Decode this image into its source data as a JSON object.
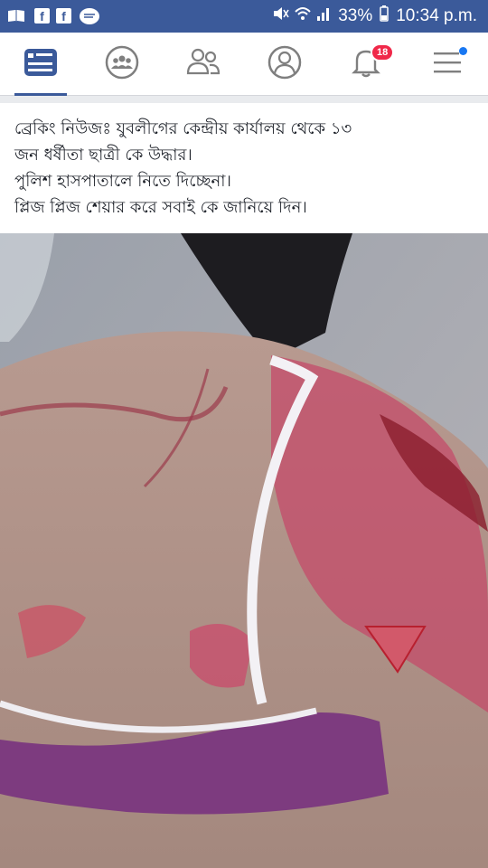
{
  "status_bar": {
    "battery": "33%",
    "time": "10:34 p.m.",
    "icons": [
      "book-icon",
      "facebook-icon",
      "facebook-icon",
      "messenger-icon",
      "mute-icon",
      "wifi-icon",
      "signal-icon",
      "battery-icon"
    ]
  },
  "nav": {
    "items": [
      {
        "name": "news-feed-icon",
        "active": true
      },
      {
        "name": "groups-icon",
        "active": false
      },
      {
        "name": "friends-icon",
        "active": false
      },
      {
        "name": "profile-icon",
        "active": false
      },
      {
        "name": "notifications-icon",
        "active": false
      },
      {
        "name": "menu-icon",
        "active": false
      }
    ],
    "notification_count": "18",
    "accent_color": "#3b5a9a",
    "badge_color": "#f02849"
  },
  "post": {
    "lines": [
      "ব্রেকিং নিউজঃ যুবলীগের কেন্দ্রীয় কার্যালয় থেকে ১৩",
      "জন ধর্ষীতা ছাত্রী কে উদ্ধার।",
      "পুলিশ হাসপাতালে নিতে দিচ্ছেনা।",
      "প্লিজ প্লিজ শেয়ার করে সবাই কে জানিয়ে দিন।"
    ]
  }
}
